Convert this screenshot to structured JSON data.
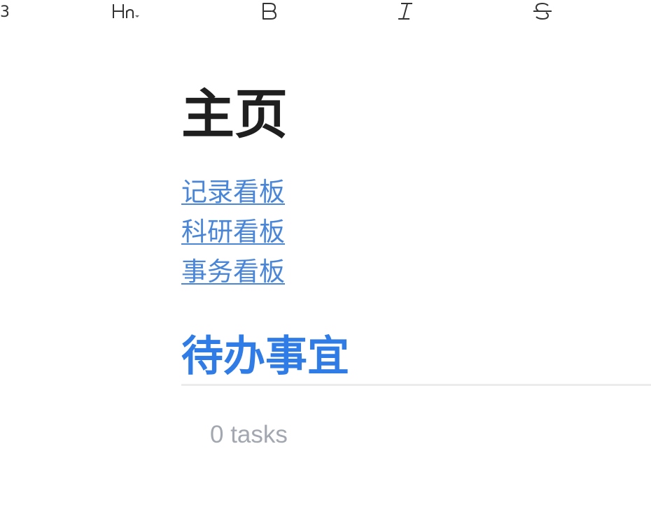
{
  "toolbar": {
    "items": [
      {
        "icon": "h3-icon",
        "label": "3"
      },
      {
        "icon": "heading-dropdown-icon",
        "label": "Hn"
      },
      {
        "icon": "bold-icon",
        "label": "B"
      },
      {
        "icon": "italic-icon",
        "label": "I"
      },
      {
        "icon": "strikethrough-icon",
        "label": "S"
      }
    ]
  },
  "page": {
    "title": "主页",
    "links": [
      {
        "label": "记录看板"
      },
      {
        "label": "科研看板"
      },
      {
        "label": "事务看板"
      }
    ]
  },
  "tasks": {
    "title": "待办事宜",
    "count_text": "0 tasks"
  },
  "colors": {
    "link": "#4a86d8",
    "section_title": "#2f7ce6",
    "muted_text": "#a3a8b0",
    "divider": "#ececec"
  }
}
